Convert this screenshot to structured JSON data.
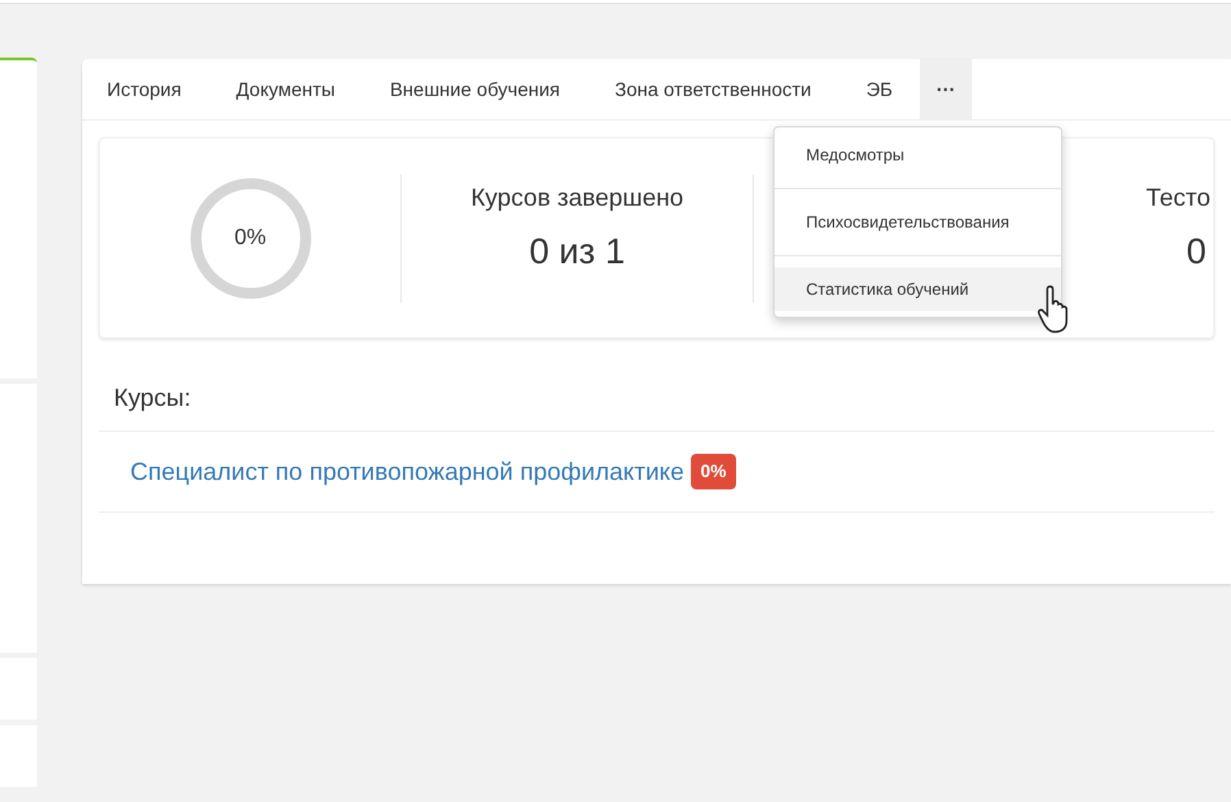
{
  "tabs": [
    {
      "label": "История",
      "selected": false
    },
    {
      "label": "Документы",
      "selected": false
    },
    {
      "label": "Внешние обучения",
      "selected": false
    },
    {
      "label": "Зона ответственности",
      "selected": false
    },
    {
      "label": "ЭБ",
      "selected": false
    },
    {
      "label": "···",
      "selected": true
    }
  ],
  "dropdown": {
    "items": [
      {
        "label": "Медосмотры",
        "hovered": false
      },
      {
        "label": "Психосвидетельствования",
        "hovered": false
      },
      {
        "label": "Статистика обучений",
        "hovered": true
      }
    ]
  },
  "stats": {
    "progress": {
      "label": "0%",
      "level": 0
    },
    "courses_done": {
      "title": "Курсов завершено",
      "value": "0 из 1"
    },
    "tests": {
      "title": "Тесто",
      "value": "0"
    }
  },
  "courses": {
    "title": "Курсы:",
    "items": [
      {
        "name": "Специалист по противопожарной профилактике",
        "badge": "0%",
        "color": "#e04b3a"
      }
    ]
  }
}
